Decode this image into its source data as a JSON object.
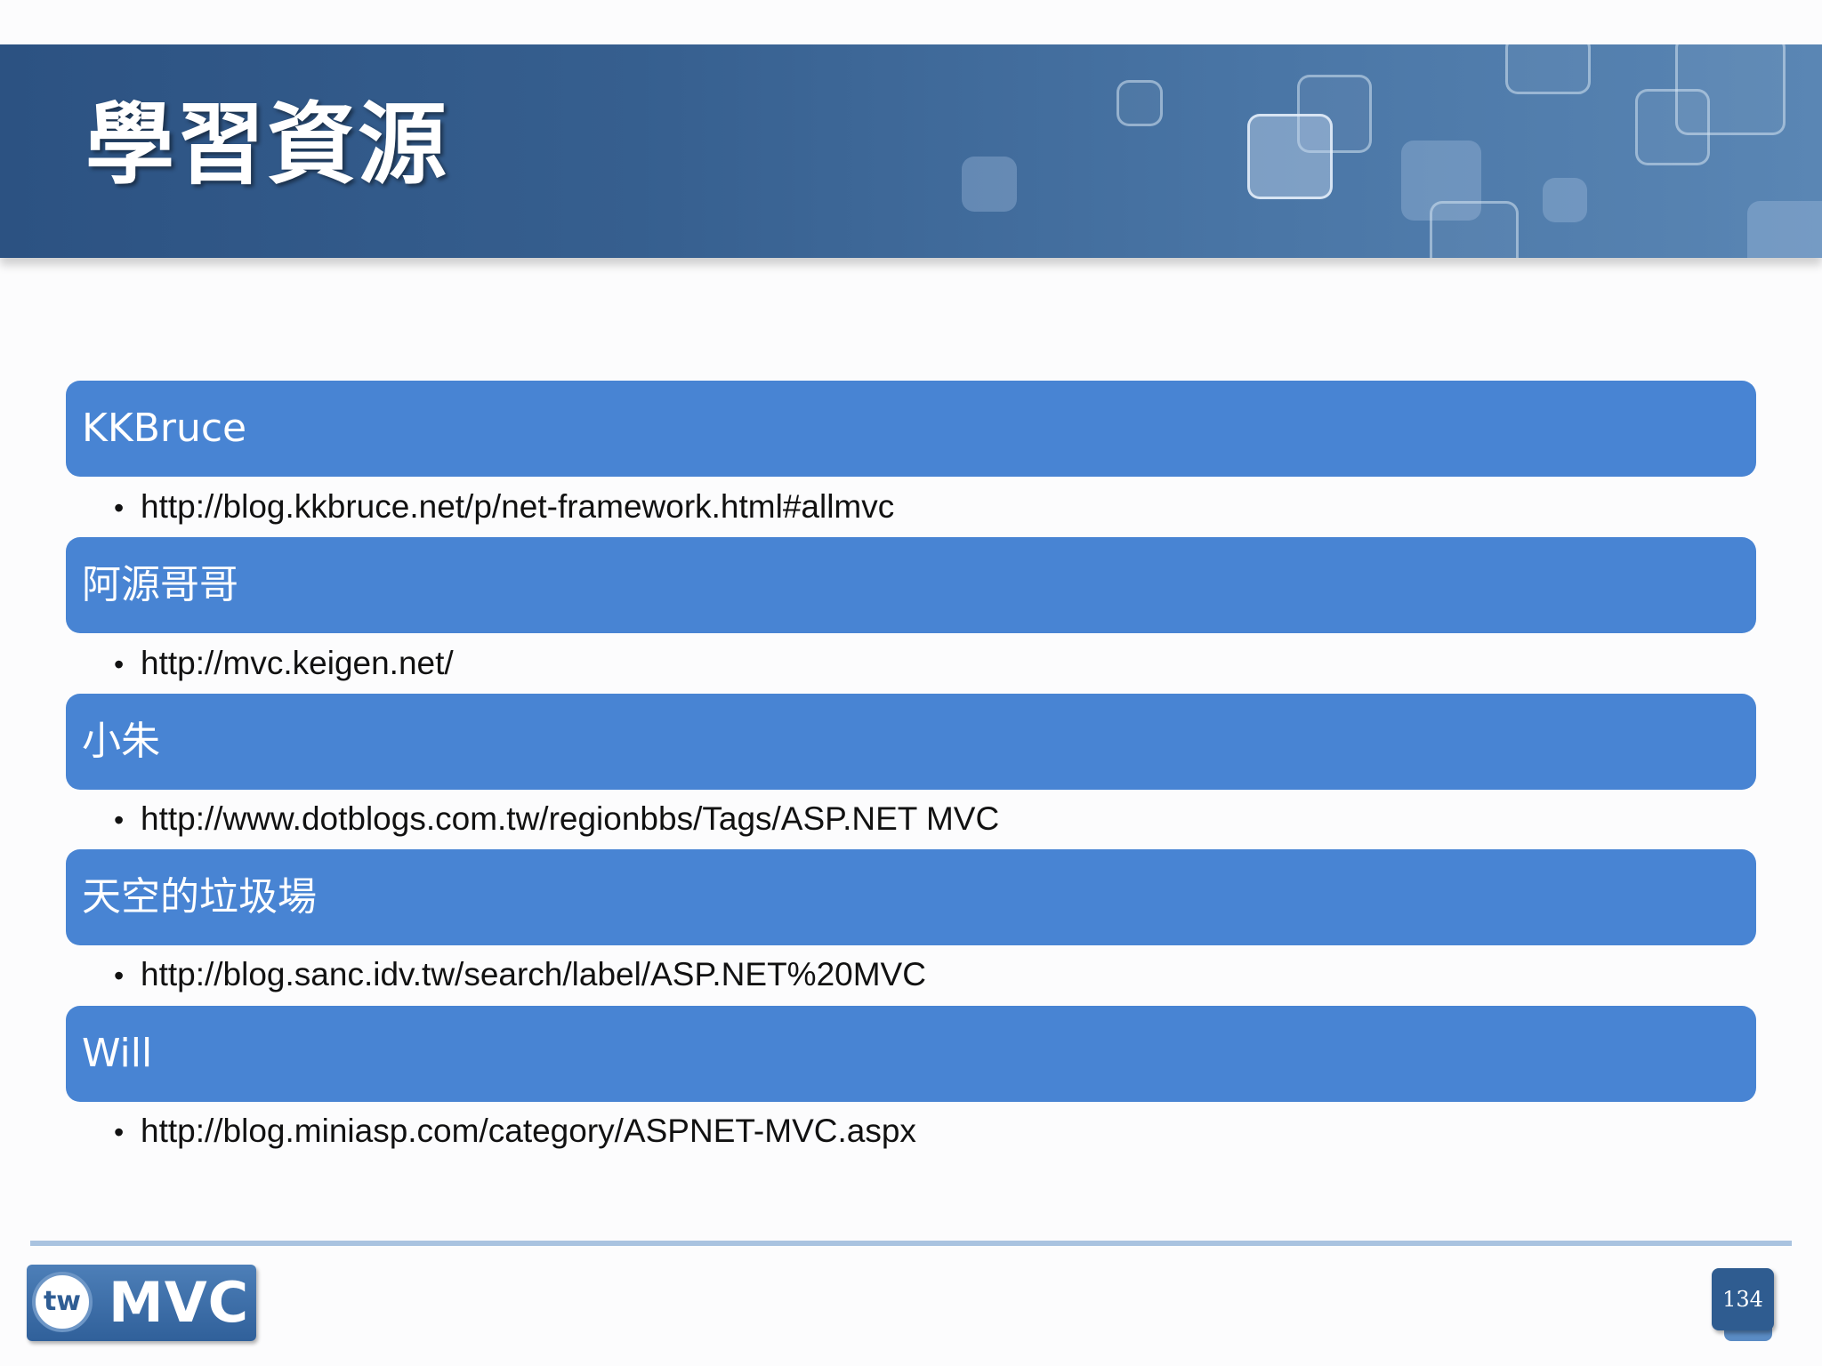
{
  "title": "學習資源",
  "sections": [
    {
      "label": "KKBruce",
      "link": "http://blog.kkbruce.net/p/net-framework.html#allmvc"
    },
    {
      "label": "阿源哥哥",
      "link": "http://mvc.keigen.net/"
    },
    {
      "label": "小朱",
      "link": "http://www.dotblogs.com.tw/regionbbs/Tags/ASP.NET MVC"
    },
    {
      "label": "天空的垃圾場",
      "link": "http://blog.sanc.idv.tw/search/label/ASP.NET%20MVC"
    },
    {
      "label": "Will",
      "link": "http://blog.miniasp.com/category/ASPNET-MVC.aspx"
    }
  ],
  "bullet": "•",
  "footer": {
    "logo_prefix": "tw",
    "logo_text": "MVC",
    "page_number": "134"
  },
  "colors": {
    "banner": "#2c5282",
    "section_bar": "#4884d3",
    "footer_line": "#a9c3e0"
  }
}
